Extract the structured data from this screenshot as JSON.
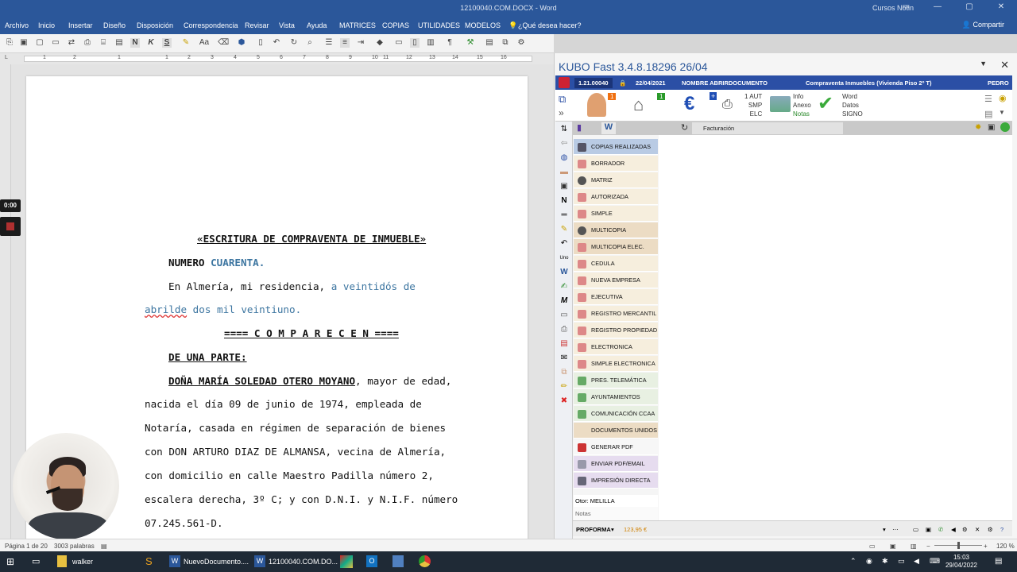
{
  "titlebar": {
    "doc_title": "12100040.COM.DOCX - Word",
    "user": "Cursos Notin",
    "minimize": "—",
    "restore": "▢",
    "close": "✕",
    "ribbon_display": "▭"
  },
  "ribbon": {
    "tabs": [
      "Archivo",
      "Inicio",
      "Insertar",
      "Diseño",
      "Disposición",
      "Correspondencia",
      "Revisar",
      "Vista",
      "Ayuda",
      "MATRICES",
      "COPIAS",
      "UTILIDADES",
      "MODELOS"
    ],
    "tell_me": "¿Qué desea hacer?",
    "share": "Compartir"
  },
  "toolbar": {
    "bold": "N",
    "italic": "K",
    "underline": "S",
    "font_size": "Aa"
  },
  "ruler": {
    "numbers": [
      "1",
      "2",
      "1",
      "1",
      "2",
      "3",
      "4",
      "5",
      "6",
      "7",
      "8",
      "9",
      "10",
      "11",
      "12",
      "13",
      "14",
      "15",
      "16"
    ]
  },
  "document": {
    "title": "«ESCRITURA DE COMPRAVENTA DE INMUEBLE»",
    "numero_label": "NUMERO",
    "numero_value": "CUARENTA.",
    "place_start": "En  Almería,  mi  residencia,",
    "place_date1": "a  veintidós  de",
    "place_date2a": "abrilde",
    "place_date2b": "dos mil veintiuno.",
    "comparecen": "==== C O M P A R E C E N ====",
    "de_una_parte": "DE UNA PARTE:",
    "person_name": "DOÑA MARÍA SOLEDAD OTERO MOYANO",
    "p1_rest": ", mayor de edad,",
    "p2": "nacida el día 09 de junio de 1974, empleada de",
    "p3": "Notaría, casada en régimen de separación de bienes",
    "p4": "con DON ARTURO DIAZ DE ALMANSA, vecina de Almería,",
    "p5": "con domicilio en calle Maestro Padilla número 2,",
    "p6": "escalera derecha, 3º C; y con D.N.I. y N.I.F. número",
    "p7": "07.245.561-D."
  },
  "recording": {
    "timer": "0:00"
  },
  "statusbar": {
    "page": "Página 1 de 20",
    "words": "3003 palabras",
    "zoom": "120 %",
    "zoom_minus": "−",
    "zoom_plus": "+"
  },
  "taskbar": {
    "items": [
      "walker",
      "NuevoDocumento....",
      "12100040.COM.DO..."
    ],
    "time": "15:03",
    "date": "29/04/2022"
  },
  "kubo": {
    "title": "KUBO Fast 3.4.8.18296   26/04",
    "number": "1.21.00040",
    "date": "22/04/2021",
    "doc_name": "NOMBRE ABRIRDOCUMENTO",
    "doc_type": "Compraventa Inmuebles (Vivienda Piso 2º T)",
    "user": "PEDRO",
    "badge1": "1",
    "badge2": "1",
    "badge_plus": "+",
    "aut_lines": [
      "1 AUT",
      "SMP",
      "ELC"
    ],
    "info_lines": [
      "Info",
      "Anexo",
      "Notas"
    ],
    "word_lines": [
      "Word",
      "Datos",
      "SIGNO"
    ],
    "word_tab": "W",
    "facturacion": "Facturación",
    "menu": [
      "COPIAS REALIZADAS",
      "BORRADOR",
      "MATRIZ",
      "AUTORIZADA",
      "SIMPLE",
      "MULTICOPIA",
      "MULTICOPIA ELEC.",
      "CEDULA",
      "NUEVA EMPRESA",
      "EJECUTIVA",
      "REGISTRO MERCANTIL",
      "REGISTRO PROPIEDAD",
      "ELECTRONICA",
      "SIMPLE ELECTRONICA",
      "PRES. TELEMÁTICA",
      "AYUNTAMIENTOS",
      "COMUNICACIÓN CCAA",
      "DOCUMENTOS UNIDOS",
      "GENERAR PDF",
      "ENVIAR PDF/EMAIL",
      "IMPRESIÓN DIRECTA"
    ],
    "otor": "Otor: MELILLA",
    "notas": "Notas",
    "proforma": "PROFORMA",
    "amount": "123,95 €"
  },
  "colors": {
    "accent": "#2b579a",
    "kubo_bar": "#2b4fa5",
    "link_text": "#3c75a0"
  }
}
